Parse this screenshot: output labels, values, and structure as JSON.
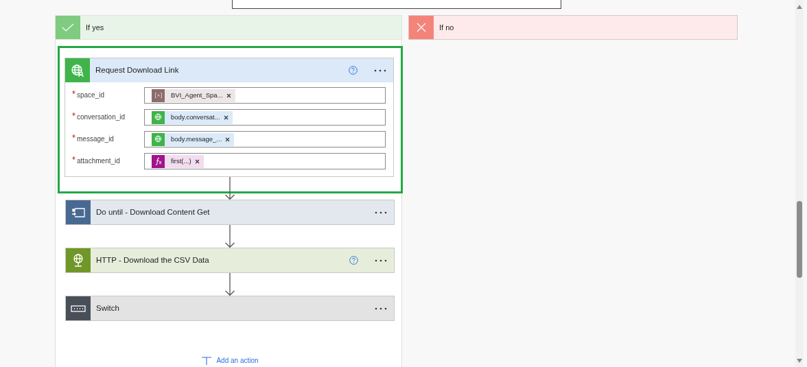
{
  "branches": [
    {
      "kind": "yes",
      "label": "If yes"
    },
    {
      "kind": "no",
      "label": "If no"
    }
  ],
  "actions": [
    {
      "kind": "connector",
      "title": "Request Download Link",
      "selected": true,
      "help": true,
      "fields": [
        {
          "label": "space_id",
          "required": true,
          "token": {
            "kind": "variable",
            "text": "BVI_Agent_Spa..."
          }
        },
        {
          "label": "conversation_id",
          "required": true,
          "token": {
            "kind": "connector",
            "text": "body.conversat..."
          }
        },
        {
          "label": "message_id",
          "required": true,
          "token": {
            "kind": "connector",
            "text": "body.message_..."
          }
        },
        {
          "label": "attachment_id",
          "required": true,
          "token": {
            "kind": "expression",
            "text": "first(...)"
          }
        }
      ]
    },
    {
      "kind": "loop",
      "title": "Do until - Download Content Get",
      "selected": false,
      "help": false
    },
    {
      "kind": "http",
      "title": "HTTP - Download the CSV Data",
      "selected": false,
      "help": true
    },
    {
      "kind": "switch",
      "title": "Switch",
      "selected": false,
      "help": false
    }
  ],
  "add_action": "Add an action"
}
